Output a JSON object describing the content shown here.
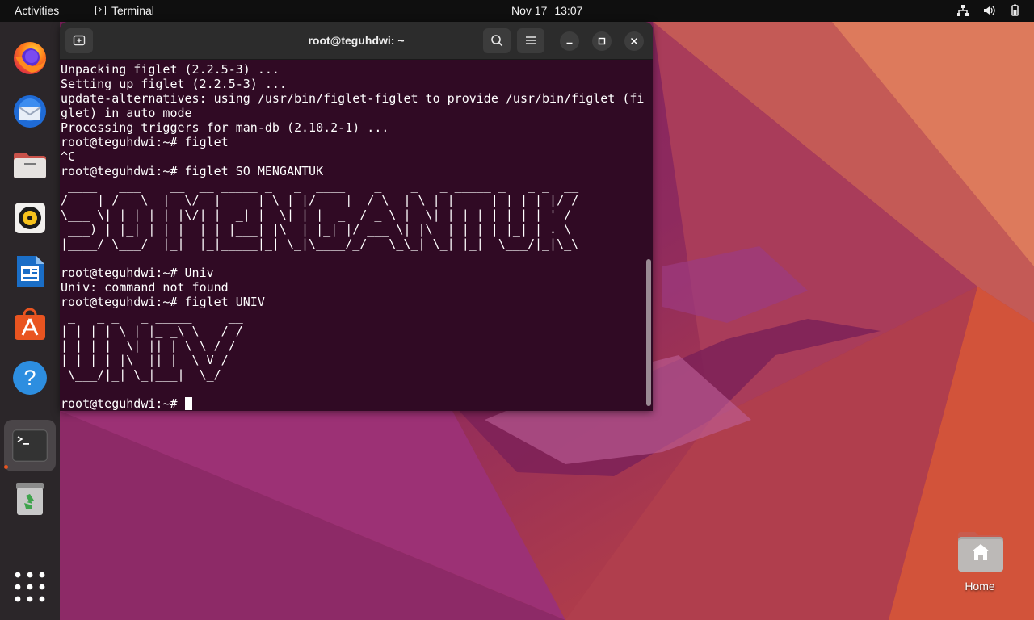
{
  "topbar": {
    "activities": "Activities",
    "app_name": "Terminal",
    "date": "Nov 17",
    "time": "13:07"
  },
  "dock": {
    "items": [
      {
        "icon": "firefox-icon"
      },
      {
        "icon": "thunderbird-icon"
      },
      {
        "icon": "files-icon"
      },
      {
        "icon": "rhythmbox-icon"
      },
      {
        "icon": "libreoffice-writer-icon"
      },
      {
        "icon": "app-center-icon"
      },
      {
        "icon": "help-icon"
      },
      {
        "icon": "terminal-icon",
        "active": true
      },
      {
        "icon": "trash-icon"
      },
      {
        "icon": "show-apps-icon"
      }
    ]
  },
  "terminal": {
    "title": "root@teguhdwi: ~",
    "output": "Unpacking figlet (2.2.5-3) ...\nSetting up figlet (2.2.5-3) ...\nupdate-alternatives: using /usr/bin/figlet-figlet to provide /usr/bin/figlet (fi\nglet) in auto mode\nProcessing triggers for man-db (2.10.2-1) ...\nroot@teguhdwi:~# figlet\n^C\nroot@teguhdwi:~# figlet SO MENGANTUK\n ____   ___    __  __ _____ _   _  ____    _    _   _ _____ _   _ _  __\n/ ___| / _ \\  |  \\/  | ____| \\ | |/ ___|  / \\  | \\ | |_   _| | | | |/ /\n\\___ \\| | | | | |\\/| |  _| |  \\| | |  _  / _ \\ |  \\| | | | | | | | ' / \n ___) | |_| | | |  | | |___| |\\  | |_| |/ ___ \\| |\\  | | | | |_| | . \\ \n|____/ \\___/  |_|  |_|_____|_| \\_|\\____/_/   \\_\\_| \\_| |_|  \\___/|_|\\_\\\n\nroot@teguhdwi:~# Univ\nUniv: command not found\nroot@teguhdwi:~# figlet UNIV\n _   _ _   _ _____     __\n| | | | \\ | |_ _\\ \\   / /\n| | | |  \\| || | \\ \\ / / \n| |_| | |\\  || |  \\ V /  \n \\___/|_| \\_|___|  \\_/   \n\n",
    "prompt": "root@teguhdwi:~# "
  },
  "desktop": {
    "home_label": "Home"
  },
  "colors": {
    "terminal_bg": "#300a24",
    "accent": "#e95420"
  }
}
